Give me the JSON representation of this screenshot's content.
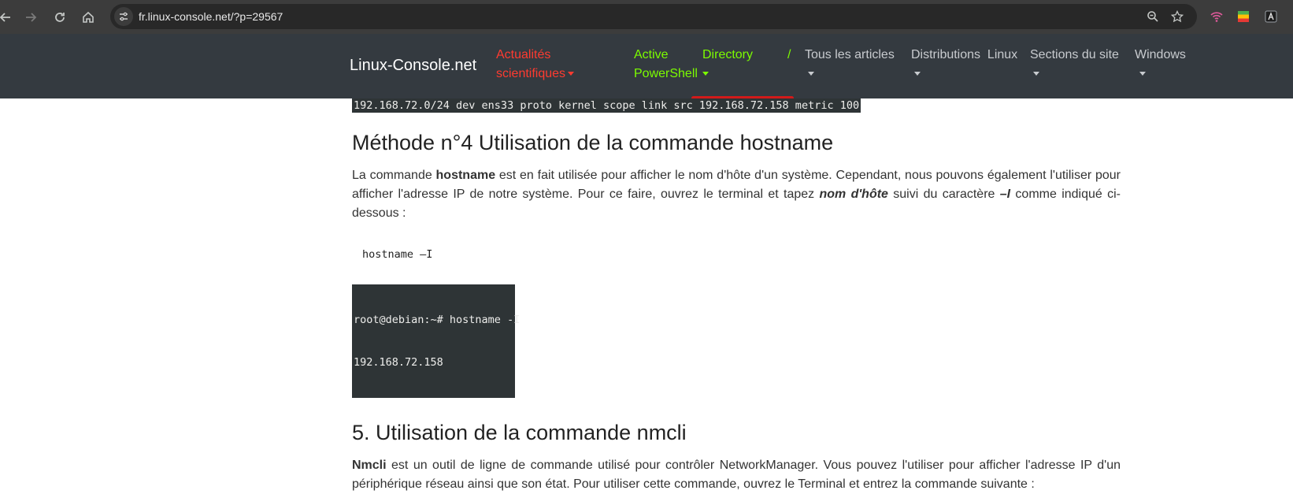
{
  "browser": {
    "url": "fr.linux-console.net/?p=29567"
  },
  "site": {
    "brand": "Linux-Console.net",
    "nav": {
      "actualites_line1": "Actualités",
      "actualites_line2": "scientifiques",
      "active_line1": "Active",
      "active_line2": "PowerShell",
      "directory": "Directory",
      "slash": "/",
      "tous": "Tous les articles",
      "distrib_word1": "Distributions",
      "distrib_word2": "Linux",
      "sections": "Sections du site",
      "windows": "Windows"
    },
    "colors": {
      "header_bg": "#343a40",
      "nav_red": "#ff3b30",
      "nav_green": "#7cfc00",
      "terminal_bg": "#2e3436"
    }
  },
  "content": {
    "route_output": "192.168.72.0/24 dev ens33 proto kernel scope link src 192.168.72.158 metric 100",
    "h_method4": "Méthode n°4 Utilisation de la commande hostname",
    "p_hostname": {
      "t1": "La commande ",
      "b1": "hostname",
      "t2": " est en fait utilisée pour afficher le nom d'hôte d'un système. Cependant, nous pouvons également l'utiliser pour afficher l'adresse IP de notre système. Pour ce faire, ouvrez le terminal et tapez ",
      "b2": "nom d'hôte",
      "t3": " suivi du caractère ",
      "b3": "–I",
      "t4": " comme indiqué ci-dessous :"
    },
    "code_hostname": "hostname –I",
    "terminal_prompt": "root@debian:~# hostname -I",
    "terminal_result": "192.168.72.158",
    "h_section5": "5. Utilisation de la commande nmcli",
    "p_nmcli": {
      "b1": "Nmcli",
      "t1": " est un outil de ligne de commande utilisé pour contrôler NetworkManager. Vous pouvez l'utiliser pour afficher l'adresse IP d'un périphérique réseau ainsi que son état. Pour utiliser cette commande, ouvrez le Terminal et entrez la commande suivante :"
    }
  }
}
